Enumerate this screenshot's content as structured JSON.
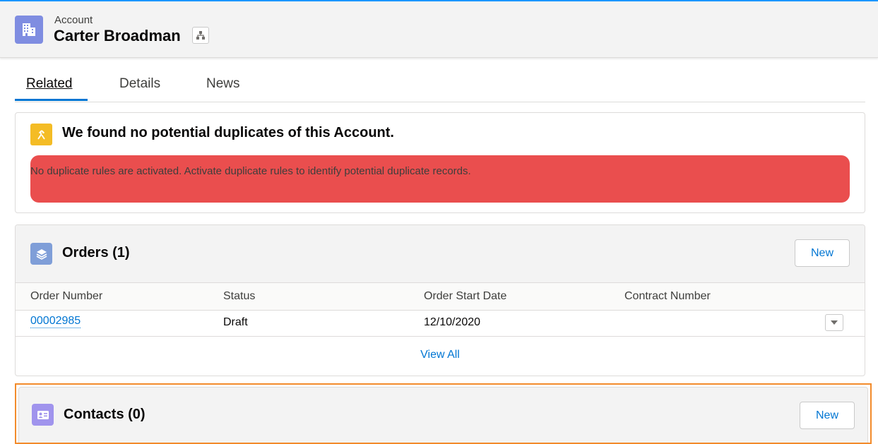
{
  "colors": {
    "account_icon": "#7f8de1",
    "duplicate_icon": "#f4bc25",
    "alert_bg": "#ea4e4e",
    "orders_icon": "#7f9ed8",
    "contacts_icon": "#a094ed",
    "link": "#0176d3",
    "highlight": "#f28b2b"
  },
  "header": {
    "object_label": "Account",
    "record_title": "Carter Broadman",
    "account_icon": "building-icon",
    "hierarchy_icon": "hierarchy-icon"
  },
  "tabs": [
    {
      "label": "Related",
      "active": true
    },
    {
      "label": "Details",
      "active": false
    },
    {
      "label": "News",
      "active": false
    }
  ],
  "duplicates": {
    "icon": "merge-icon",
    "title": "We found no potential duplicates of this Account.",
    "message": "No duplicate rules are activated. Activate duplicate rules to identify potential duplicate records."
  },
  "orders": {
    "icon": "stack-icon",
    "title": "Orders (1)",
    "new_label": "New",
    "columns": [
      "Order Number",
      "Status",
      "Order Start Date",
      "Contract Number"
    ],
    "rows": [
      {
        "order_number": "00002985",
        "status": "Draft",
        "start_date": "12/10/2020",
        "contract_number": ""
      }
    ],
    "view_all": "View All"
  },
  "contacts": {
    "icon": "contact-card-icon",
    "title": "Contacts (0)",
    "new_label": "New"
  }
}
